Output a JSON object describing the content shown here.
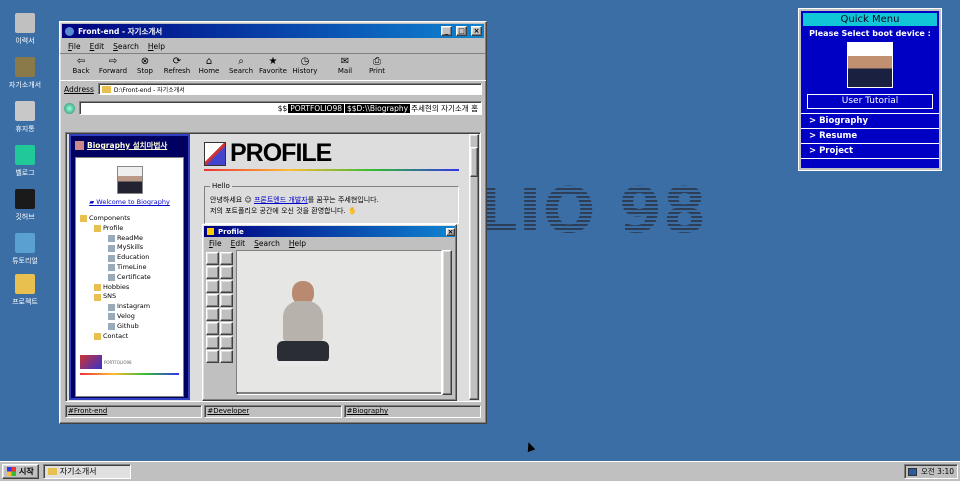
{
  "desktop": {
    "icons": [
      {
        "label": "이력서",
        "color": "#c0c0c0"
      },
      {
        "label": "자기소개서",
        "color": "#8a7a4a"
      },
      {
        "label": "휴지통",
        "color": "#c8c8c8"
      },
      {
        "label": "벨로그",
        "color": "#20c997"
      },
      {
        "label": "깃허브",
        "color": "#1a1a1a"
      },
      {
        "label": "튜토리얼",
        "color": "#5aa0d0"
      },
      {
        "label": "프로젝트",
        "color": "#e8c050"
      }
    ],
    "watermark": "LIO 98"
  },
  "window": {
    "title": "Front-end - 자기소개서",
    "menu": [
      "File",
      "Edit",
      "Search",
      "Help"
    ],
    "toolbar": [
      {
        "label": "Back",
        "icon": "back-arrow-icon",
        "g": "⇦"
      },
      {
        "label": "Forward",
        "icon": "forward-arrow-icon",
        "g": "⇨"
      },
      {
        "label": "Stop",
        "icon": "stop-icon",
        "g": "⊗"
      },
      {
        "label": "Refresh",
        "icon": "refresh-icon",
        "g": "⟳"
      },
      {
        "label": "Home",
        "icon": "home-icon",
        "g": "⌂"
      },
      {
        "label": "Search",
        "icon": "search-icon",
        "g": "⌕"
      },
      {
        "label": "Favorite",
        "icon": "favorite-icon",
        "g": "★"
      },
      {
        "label": "History",
        "icon": "history-icon",
        "g": "◷"
      },
      {
        "label": "Mail",
        "icon": "mail-icon",
        "g": "✉"
      },
      {
        "label": "Print",
        "icon": "print-icon",
        "g": "⎙"
      }
    ],
    "address_label": "Address",
    "address_value": "D:\\Front-end - 자기소개서",
    "marquee": {
      "pre": "$$",
      "brand": "PORTFOLIO98",
      "mid": "$$D:\\\\Biography",
      "post": "주세현의 자기소개 홈"
    },
    "status": [
      "#Front-end",
      "#Developer",
      "#Biography"
    ]
  },
  "sidebar": {
    "title": "Biography 설치마법사",
    "welcome": "Welcome to Biography",
    "tree": [
      {
        "label": "Components",
        "depth": 0
      },
      {
        "label": "Profile",
        "depth": 1
      },
      {
        "label": "ReadMe",
        "depth": 2
      },
      {
        "label": "MySkills",
        "depth": 2
      },
      {
        "label": "Education",
        "depth": 2
      },
      {
        "label": "TimeLine",
        "depth": 2
      },
      {
        "label": "Certificate",
        "depth": 2
      },
      {
        "label": "Hobbies",
        "depth": 1
      },
      {
        "label": "SNS",
        "depth": 1
      },
      {
        "label": "Instagram",
        "depth": 2
      },
      {
        "label": "Velog",
        "depth": 2
      },
      {
        "label": "Github",
        "depth": 2
      },
      {
        "label": "Contact",
        "depth": 1
      }
    ],
    "footer": "PORTFOLIO98"
  },
  "content": {
    "heading": "PROFILE",
    "hello_title": "Hello",
    "hello_line1_pre": "안녕하세요 ",
    "hello_link": "프론트엔드 개발자",
    "hello_line1_post": "를 꿈꾸는 주세현입니다.",
    "hello_line2": "저의 포트폴리오 공간에 오신 것을 환영합니다."
  },
  "paint": {
    "title": "Profile",
    "menu": [
      "File",
      "Edit",
      "Search",
      "Help"
    ]
  },
  "quickmenu": {
    "title": "Quick Menu",
    "subtitle": "Please Select boot device :",
    "tutorial": "User Tutorial",
    "links": [
      "> Biography",
      "> Resume",
      "> Project"
    ]
  },
  "taskbar": {
    "start": "시작",
    "task": "자기소개서",
    "clock": "오전 3:10"
  }
}
